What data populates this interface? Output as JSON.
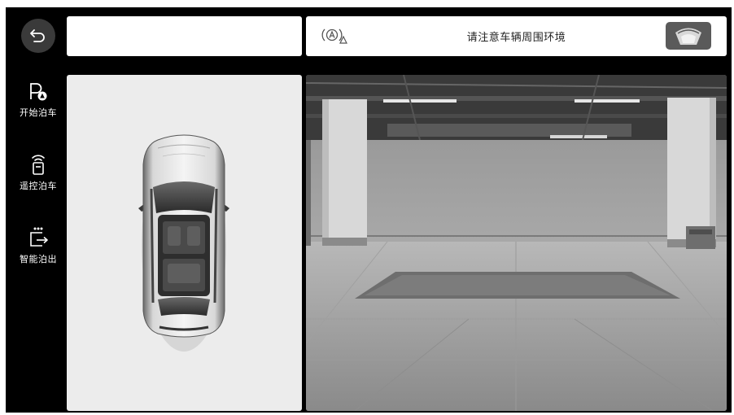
{
  "sidebar": {
    "back_icon": "back-arrow-icon",
    "items": [
      {
        "label": "开始泊车",
        "icon": "parking-start-icon"
      },
      {
        "label": "遥控泊车",
        "icon": "remote-parking-icon"
      },
      {
        "label": "智能泊出",
        "icon": "smart-exit-icon"
      }
    ]
  },
  "topbar": {
    "notice": "请注意车辆周围环境",
    "assist_icon": "driving-assist-warning-icon",
    "view_icon": "camera-view-icon"
  },
  "views": {
    "car_view": "top-down-car-view",
    "camera_view": "parking-garage-camera-feed"
  },
  "colors": {
    "screen_bg": "#000000",
    "panel_bg": "#ececec",
    "button_bg": "#3a3a3a",
    "text_light": "#ffffff",
    "text_dark": "#222222"
  }
}
